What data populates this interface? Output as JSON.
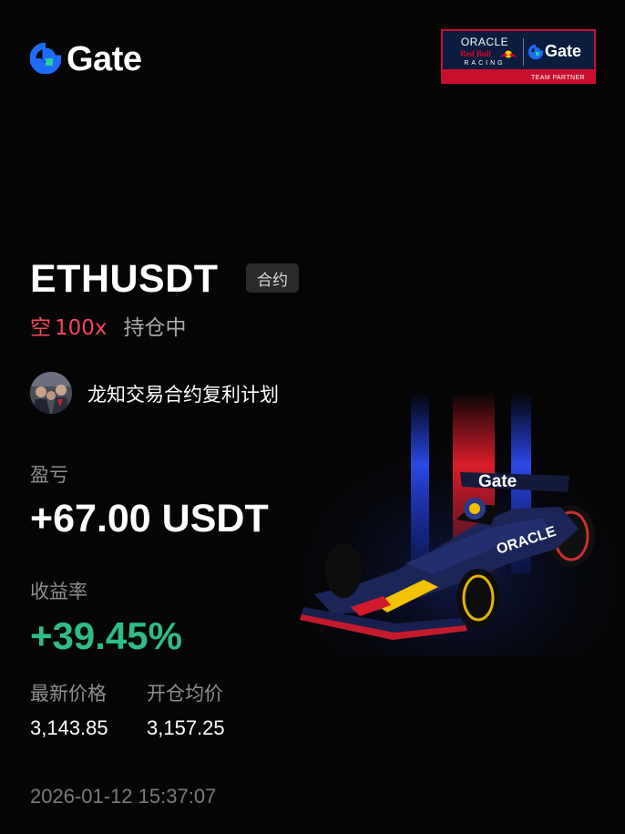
{
  "brand": {
    "logo_text": "Gate",
    "logo_icon": "gate-logo-icon",
    "accent": "#1e6bff"
  },
  "partner_badge": {
    "oracle": "ORACLE",
    "red_bull": "Red Bull",
    "racing": "RACING",
    "gate": "Gate",
    "label": "TEAM PARTNER"
  },
  "position": {
    "symbol": "ETHUSDT",
    "type_tag": "合约",
    "side": "空",
    "leverage": "100x",
    "status": "持仓中",
    "side_color": "#f6465d"
  },
  "trader": {
    "plan_name": "龙知交易合约复利计划",
    "avatar_icon": "avatar-photo"
  },
  "pnl": {
    "label": "盈亏",
    "value": "+67.00 USDT"
  },
  "roi": {
    "label": "收益率",
    "value": "+39.45%",
    "color": "#2ebd85"
  },
  "prices": {
    "last_label": "最新价格",
    "last_value": "3,143.85",
    "entry_label": "开仓均价",
    "entry_value": "3,157.25"
  },
  "timestamp": "2026-01-12 15:37:07",
  "car_image": {
    "icon": "f1-car-illustration",
    "sidepod_text": "ORACLE",
    "wing_text": "Gate"
  }
}
